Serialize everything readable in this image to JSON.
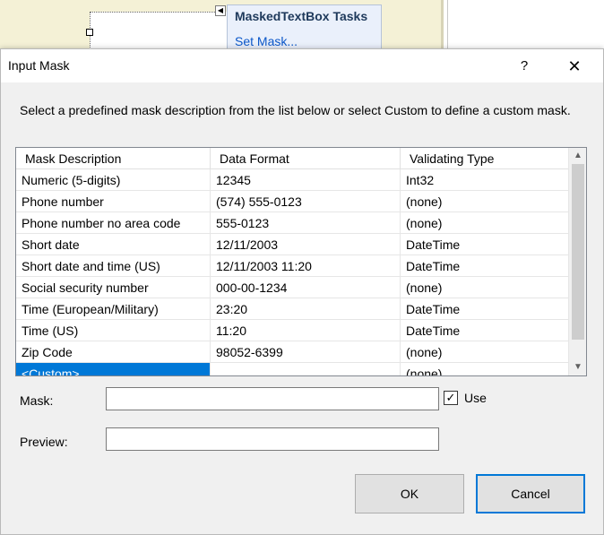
{
  "designer": {
    "tasks_panel_title": "MaskedTextBox Tasks",
    "set_mask_link": "Set Mask...",
    "tasks_glyph": "◀"
  },
  "dialog": {
    "title": "Input Mask",
    "help_glyph": "?",
    "close_glyph": "✕",
    "instructions": "Select a predefined mask description from the list below or select Custom to define a custom mask.",
    "list": {
      "columns": [
        "Mask Description",
        "Data Format",
        "Validating Type"
      ],
      "rows": [
        [
          "Numeric (5-digits)",
          "12345",
          "Int32"
        ],
        [
          "Phone number",
          "(574) 555-0123",
          "(none)"
        ],
        [
          "Phone number no area code",
          "555-0123",
          "(none)"
        ],
        [
          "Short date",
          "12/11/2003",
          "DateTime"
        ],
        [
          "Short date and time (US)",
          "12/11/2003 11:20",
          "DateTime"
        ],
        [
          "Social security number",
          "000-00-1234",
          "(none)"
        ],
        [
          "Time (European/Military)",
          "23:20",
          "DateTime"
        ],
        [
          "Time (US)",
          "11:20",
          "DateTime"
        ],
        [
          "Zip Code",
          "98052-6399",
          "(none)"
        ],
        [
          "<Custom>",
          "",
          "(none)"
        ]
      ],
      "selected_row_index": 9,
      "scroll_up_glyph": "▲",
      "scroll_down_glyph": "▼"
    },
    "mask_label": "Mask:",
    "mask_value": "",
    "use_checked": true,
    "use_check_glyph": "✓",
    "use_label": "Use",
    "preview_label": "Preview:",
    "preview_value": "",
    "ok_label": "OK",
    "cancel_label": "Cancel"
  },
  "colors": {
    "selection": "#0078d7",
    "link": "#0b57c9",
    "designer_surface": "#f4f1d6",
    "tasks_panel": "#eaf0fb"
  }
}
